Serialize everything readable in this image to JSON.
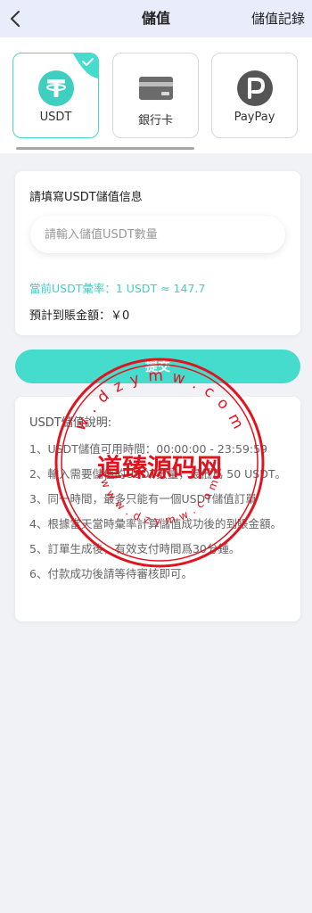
{
  "header": {
    "title": "儲值",
    "history_link": "儲值記錄"
  },
  "methods": [
    {
      "label": "USDT",
      "icon": "tether-icon",
      "selected": true
    },
    {
      "label": "銀行卡",
      "icon": "bank-card-icon",
      "selected": false
    },
    {
      "label": "PayPay",
      "icon": "paypay-icon",
      "selected": false
    }
  ],
  "form": {
    "title": "請填寫USDT儲值信息",
    "amount_placeholder": "請輸入儲值USDT數量",
    "amount_value": "",
    "rate_text": "當前USDT彙率：1 USDT ≈ 147.7",
    "estimate_label": "預計到賬金額：",
    "estimate_value": "￥0"
  },
  "submit_label": "提交",
  "notes": {
    "title": "USDT儲值說明:",
    "items": [
      "1、USDT儲值可用時間：00:00:00 - 23:59:59",
      "2、輸入需要儲值的USDT數量，最低爲 50 USDT。",
      "3、同一時間，最多只能有一個USDT儲值訂單",
      "4、根據當天當時彙率計算儲值成功後的到賬金額。",
      "5、訂單生成後，有效支付時間爲30分鍾。",
      "6、付款成功後請等待審核即可。"
    ]
  },
  "watermark": {
    "center_text": "道臻源码网",
    "ring_top": "w . d z y m w . c o m",
    "ring_bottom": "w w w . d z y m w . c o m"
  },
  "colors": {
    "accent": "#45dccd",
    "stamp": "#e0141e",
    "header_bg": "#e8ecfb"
  }
}
